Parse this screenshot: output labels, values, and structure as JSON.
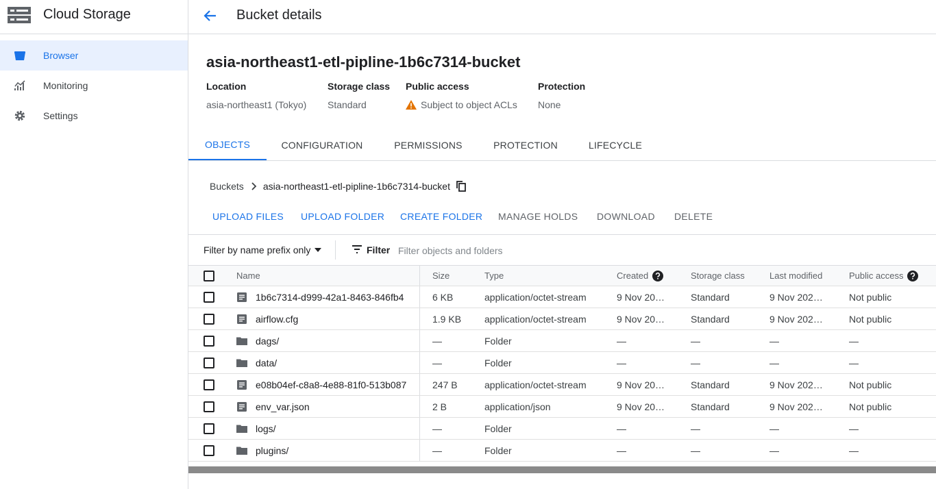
{
  "app": {
    "title": "Cloud Storage"
  },
  "sidebar": {
    "items": [
      {
        "label": "Browser",
        "icon": "bucket-icon",
        "active": true
      },
      {
        "label": "Monitoring",
        "icon": "chart-icon",
        "active": false
      },
      {
        "label": "Settings",
        "icon": "gear-icon",
        "active": false
      }
    ]
  },
  "header": {
    "title": "Bucket details"
  },
  "bucket": {
    "name": "asia-northeast1-etl-pipline-1b6c7314-bucket",
    "meta": [
      {
        "label": "Location",
        "value": "asia-northeast1 (Tokyo)"
      },
      {
        "label": "Storage class",
        "value": "Standard"
      },
      {
        "label": "Public access",
        "value": "Subject to object ACLs",
        "icon": "warning-icon"
      },
      {
        "label": "Protection",
        "value": "None"
      }
    ]
  },
  "tabs": [
    {
      "label": "OBJECTS",
      "active": true
    },
    {
      "label": "CONFIGURATION",
      "active": false
    },
    {
      "label": "PERMISSIONS",
      "active": false
    },
    {
      "label": "PROTECTION",
      "active": false
    },
    {
      "label": "LIFECYCLE",
      "active": false
    }
  ],
  "breadcrumb": {
    "root": "Buckets",
    "current": "asia-northeast1-etl-pipline-1b6c7314-bucket"
  },
  "actions": {
    "upload_files": "UPLOAD FILES",
    "upload_folder": "UPLOAD FOLDER",
    "create_folder": "CREATE FOLDER",
    "manage_holds": "MANAGE HOLDS",
    "download": "DOWNLOAD",
    "delete": "DELETE"
  },
  "filter": {
    "mode": "Filter by name prefix only",
    "label": "Filter",
    "placeholder": "Filter objects and folders"
  },
  "table": {
    "columns": {
      "name": "Name",
      "size": "Size",
      "type": "Type",
      "created": "Created",
      "storage_class": "Storage class",
      "last_modified": "Last modified",
      "public_access": "Public access"
    },
    "rows": [
      {
        "kind": "file",
        "name": "1b6c7314-d999-42a1-8463-846fb4",
        "size": "6 KB",
        "type": "application/octet-stream",
        "created": "9 Nov 20…",
        "storage_class": "Standard",
        "last_modified": "9 Nov 202…",
        "public_access": "Not public"
      },
      {
        "kind": "file",
        "name": "airflow.cfg",
        "size": "1.9 KB",
        "type": "application/octet-stream",
        "created": "9 Nov 20…",
        "storage_class": "Standard",
        "last_modified": "9 Nov 202…",
        "public_access": "Not public"
      },
      {
        "kind": "folder",
        "name": "dags/",
        "size": "—",
        "type": "Folder",
        "created": "—",
        "storage_class": "—",
        "last_modified": "—",
        "public_access": "—"
      },
      {
        "kind": "folder",
        "name": "data/",
        "size": "—",
        "type": "Folder",
        "created": "—",
        "storage_class": "—",
        "last_modified": "—",
        "public_access": "—"
      },
      {
        "kind": "file",
        "name": "e08b04ef-c8a8-4e88-81f0-513b087",
        "size": "247 B",
        "type": "application/octet-stream",
        "created": "9 Nov 20…",
        "storage_class": "Standard",
        "last_modified": "9 Nov 202…",
        "public_access": "Not public"
      },
      {
        "kind": "file",
        "name": "env_var.json",
        "size": "2 B",
        "type": "application/json",
        "created": "9 Nov 20…",
        "storage_class": "Standard",
        "last_modified": "9 Nov 202…",
        "public_access": "Not public"
      },
      {
        "kind": "folder",
        "name": "logs/",
        "size": "—",
        "type": "Folder",
        "created": "—",
        "storage_class": "—",
        "last_modified": "—",
        "public_access": "—"
      },
      {
        "kind": "folder",
        "name": "plugins/",
        "size": "—",
        "type": "Folder",
        "created": "—",
        "storage_class": "—",
        "last_modified": "—",
        "public_access": "—"
      }
    ]
  },
  "colors": {
    "accent": "#1a73e8",
    "active_bg": "#e8f0fe",
    "warning": "#e37400",
    "border": "#dadce0"
  }
}
